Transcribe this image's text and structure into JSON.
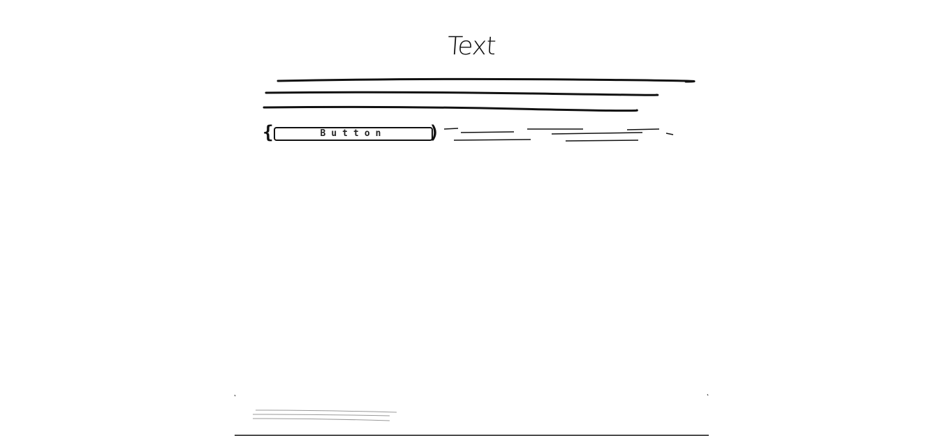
{
  "wireframe": {
    "title": "Text",
    "button_label": "Button"
  },
  "colors": {
    "ink": "#111111",
    "faint_ink": "#999999",
    "background": "#ffffff"
  }
}
